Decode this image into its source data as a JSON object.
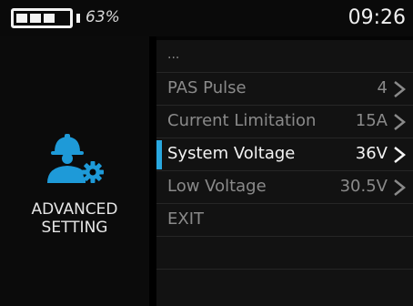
{
  "status": {
    "battery_percent": "63%",
    "battery_level": 0.63,
    "time": "09:26"
  },
  "side": {
    "icon": "engineer-gear-icon",
    "title_line1": "ADVANCED",
    "title_line2": "SETTING"
  },
  "menu": {
    "items": [
      {
        "label": "...",
        "value": ""
      },
      {
        "label": "PAS Pulse",
        "value": "4"
      },
      {
        "label": "Current Limitation",
        "value": "15A"
      },
      {
        "label": "System Voltage",
        "value": "36V",
        "selected": true
      },
      {
        "label": "Low Voltage",
        "value": "30.5V"
      },
      {
        "label": "EXIT",
        "value": ""
      }
    ]
  },
  "colors": {
    "accent": "#29a8e0",
    "icon": "#1e9ad8"
  }
}
